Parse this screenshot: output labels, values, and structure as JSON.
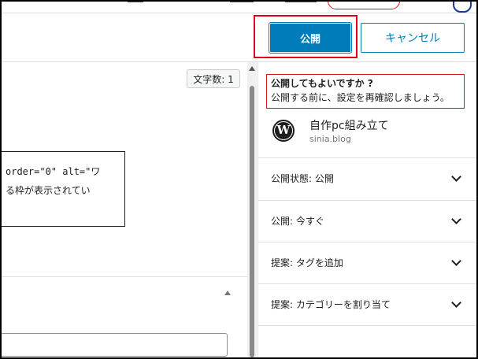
{
  "header": {
    "publish_label": "公開",
    "cancel_label": "キャンセル"
  },
  "editor": {
    "word_count": "文字数: 1",
    "code_line1": "order=\"0\" alt=\"ワ",
    "code_line2": "る枠が表示されてい"
  },
  "sidebar": {
    "confirm_title": "公開してもよいですか ?",
    "confirm_subtitle": "公開する前に、設定を再確認しましょう。",
    "site_name": "自作pc組み立て",
    "site_url": "sinia.blog",
    "panels": [
      {
        "label": "公開状態: 公開"
      },
      {
        "label": "公開: 今すぐ"
      },
      {
        "label": "提案: タグを追加"
      },
      {
        "label": "提案: カテゴリーを割り当て"
      }
    ]
  },
  "icons": {
    "site_logo": "wordpress-icon",
    "panel_toggle": "chevron-down-icon"
  },
  "colors": {
    "accent": "#007cba",
    "highlight": "#cc1818"
  }
}
